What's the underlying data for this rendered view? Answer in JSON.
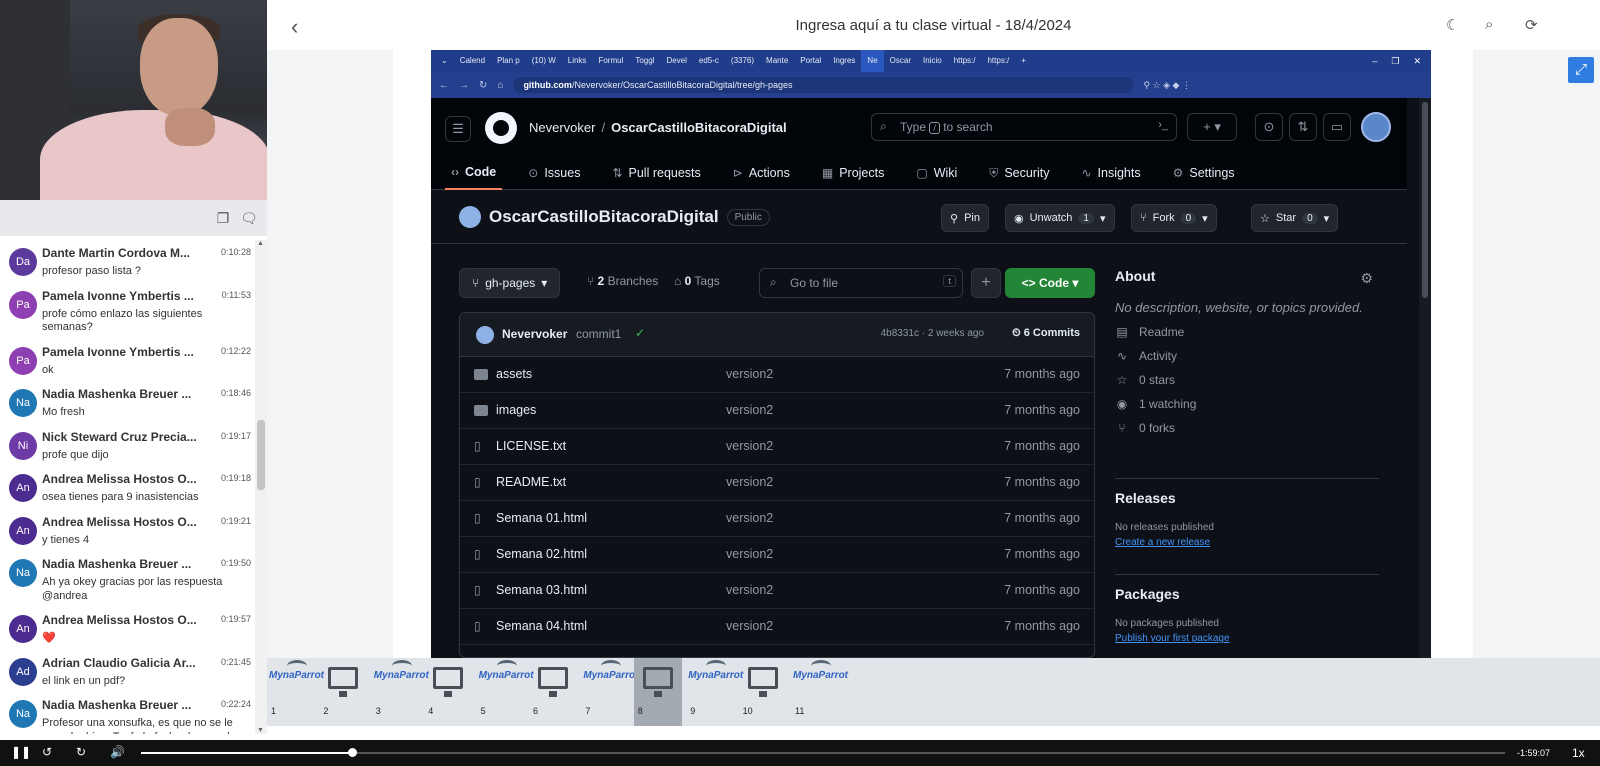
{
  "header": {
    "title": "Ingresa aquí a tu clase virtual - 18/4/2024"
  },
  "chat": {
    "messages": [
      {
        "initials": "Da",
        "color": "#5c3a9b",
        "name": "Dante Martin Cordova M...",
        "time": "0:10:28",
        "text": "profesor paso lista ?"
      },
      {
        "initials": "Pa",
        "color": "#8e3fb1",
        "name": "Pamela Ivonne Ymbertis ...",
        "time": "0:11:53",
        "text": "profe cómo enlazo las siguientes semanas?"
      },
      {
        "initials": "Pa",
        "color": "#8e3fb1",
        "name": "Pamela Ivonne Ymbertis ...",
        "time": "0:12:22",
        "text": "ok"
      },
      {
        "initials": "Na",
        "color": "#1f78b4",
        "name": "Nadia Mashenka Breuer ...",
        "time": "0:18:46",
        "text": "Mo fresh"
      },
      {
        "initials": "Ni",
        "color": "#6d3aa6",
        "name": "Nick Steward Cruz Precia...",
        "time": "0:19:17",
        "text": "profe que dijo"
      },
      {
        "initials": "An",
        "color": "#4c2c91",
        "name": "Andrea Melissa Hostos O...",
        "time": "0:19:18",
        "text": "osea tienes para 9 inasistencias"
      },
      {
        "initials": "An",
        "color": "#4c2c91",
        "name": "Andrea Melissa Hostos O...",
        "time": "0:19:21",
        "text": "y tienes 4"
      },
      {
        "initials": "Na",
        "color": "#1f78b4",
        "name": "Nadia Mashenka Breuer ...",
        "time": "0:19:50",
        "text": "Ah ya okey gracias por las respuesta @andrea"
      },
      {
        "initials": "An",
        "color": "#4c2c91",
        "name": "Andrea Melissa Hostos O...",
        "time": "0:19:57",
        "text": "❤️"
      },
      {
        "initials": "Ad",
        "color": "#2c3e8f",
        "name": "Adrian Claudio Galicia Ar...",
        "time": "0:21:45",
        "text": "el link en un pdf?"
      },
      {
        "initials": "Na",
        "color": "#1f78b4",
        "name": "Nadia Mashenka Breuer ...",
        "time": "0:22:24",
        "text": "Profesor una xonsufka, es que no se le escucha bien. Tenfo la fecha de que el entregabke de la bitacora es para manana, cierto?"
      }
    ]
  },
  "browser": {
    "tabs": [
      "Calend",
      "Plan p",
      "(10) W",
      "Links",
      "Formul",
      "Toggl",
      "Devel",
      "ed5-c",
      "(3376)",
      "Mante",
      "Portal",
      "Ingres",
      "Ne",
      "Oscar",
      "Inicio",
      "https:/",
      "https:/"
    ],
    "active_tab_index": 12,
    "url_host": "github.com",
    "url_path": "/Nevervoker/OscarCastilloBitacoraDigital/tree/gh-pages"
  },
  "github": {
    "owner": "Nevervoker",
    "repo": "OscarCastilloBitacoraDigital",
    "search_placeholder_pre": "Type",
    "search_key": "/",
    "search_placeholder_post": "to search",
    "nav": [
      "Code",
      "Issues",
      "Pull requests",
      "Actions",
      "Projects",
      "Wiki",
      "Security",
      "Insights",
      "Settings"
    ],
    "visibility": "Public",
    "pin": "Pin",
    "unwatch": "Unwatch",
    "watch_count": "1",
    "fork": "Fork",
    "fork_count": "0",
    "star": "Star",
    "star_count": "0",
    "branch": "gh-pages",
    "branches_count": "2",
    "branches_label": "Branches",
    "tags_count": "0",
    "tags_label": "Tags",
    "gofile_placeholder": "Go to file",
    "gofile_key": "t",
    "code_button": "Code",
    "commit": {
      "author": "Nevervoker",
      "message": "commit1",
      "hash": "4b8331c · 2 weeks ago",
      "commits": "6 Commits"
    },
    "files": [
      {
        "name": "assets",
        "type": "folder",
        "message": "version2",
        "age": "7 months ago"
      },
      {
        "name": "images",
        "type": "folder",
        "message": "version2",
        "age": "7 months ago"
      },
      {
        "name": "LICENSE.txt",
        "type": "file",
        "message": "version2",
        "age": "7 months ago"
      },
      {
        "name": "README.txt",
        "type": "file",
        "message": "version2",
        "age": "7 months ago"
      },
      {
        "name": "Semana 01.html",
        "type": "file",
        "message": "version2",
        "age": "7 months ago"
      },
      {
        "name": "Semana 02.html",
        "type": "file",
        "message": "version2",
        "age": "7 months ago"
      },
      {
        "name": "Semana 03.html",
        "type": "file",
        "message": "version2",
        "age": "7 months ago"
      },
      {
        "name": "Semana 04.html",
        "type": "file",
        "message": "version2",
        "age": "7 months ago"
      }
    ],
    "about": {
      "title": "About",
      "description": "No description, website, or topics provided.",
      "items": [
        "Readme",
        "Activity",
        "0 stars",
        "1 watching",
        "0 forks"
      ]
    },
    "releases": {
      "title": "Releases",
      "none": "No releases published",
      "link": "Create a new release"
    },
    "packages": {
      "title": "Packages",
      "none": "No packages published",
      "link": "Publish your first package"
    }
  },
  "thumbnails": {
    "selected": "8",
    "items": [
      {
        "num": "1",
        "kind": "logo"
      },
      {
        "num": "2",
        "kind": "monitor"
      },
      {
        "num": "3",
        "kind": "logo"
      },
      {
        "num": "4",
        "kind": "monitor"
      },
      {
        "num": "5",
        "kind": "logo"
      },
      {
        "num": "6",
        "kind": "monitor"
      },
      {
        "num": "7",
        "kind": "logo"
      },
      {
        "num": "8",
        "kind": "monitor"
      },
      {
        "num": "9",
        "kind": "logo"
      },
      {
        "num": "10",
        "kind": "monitor"
      },
      {
        "num": "11",
        "kind": "logo"
      }
    ],
    "logo_text": "MynaParrot"
  },
  "player": {
    "remaining": "-1:59:07",
    "speed": "1x",
    "progress": 0.155,
    "buffered": 0.28
  }
}
